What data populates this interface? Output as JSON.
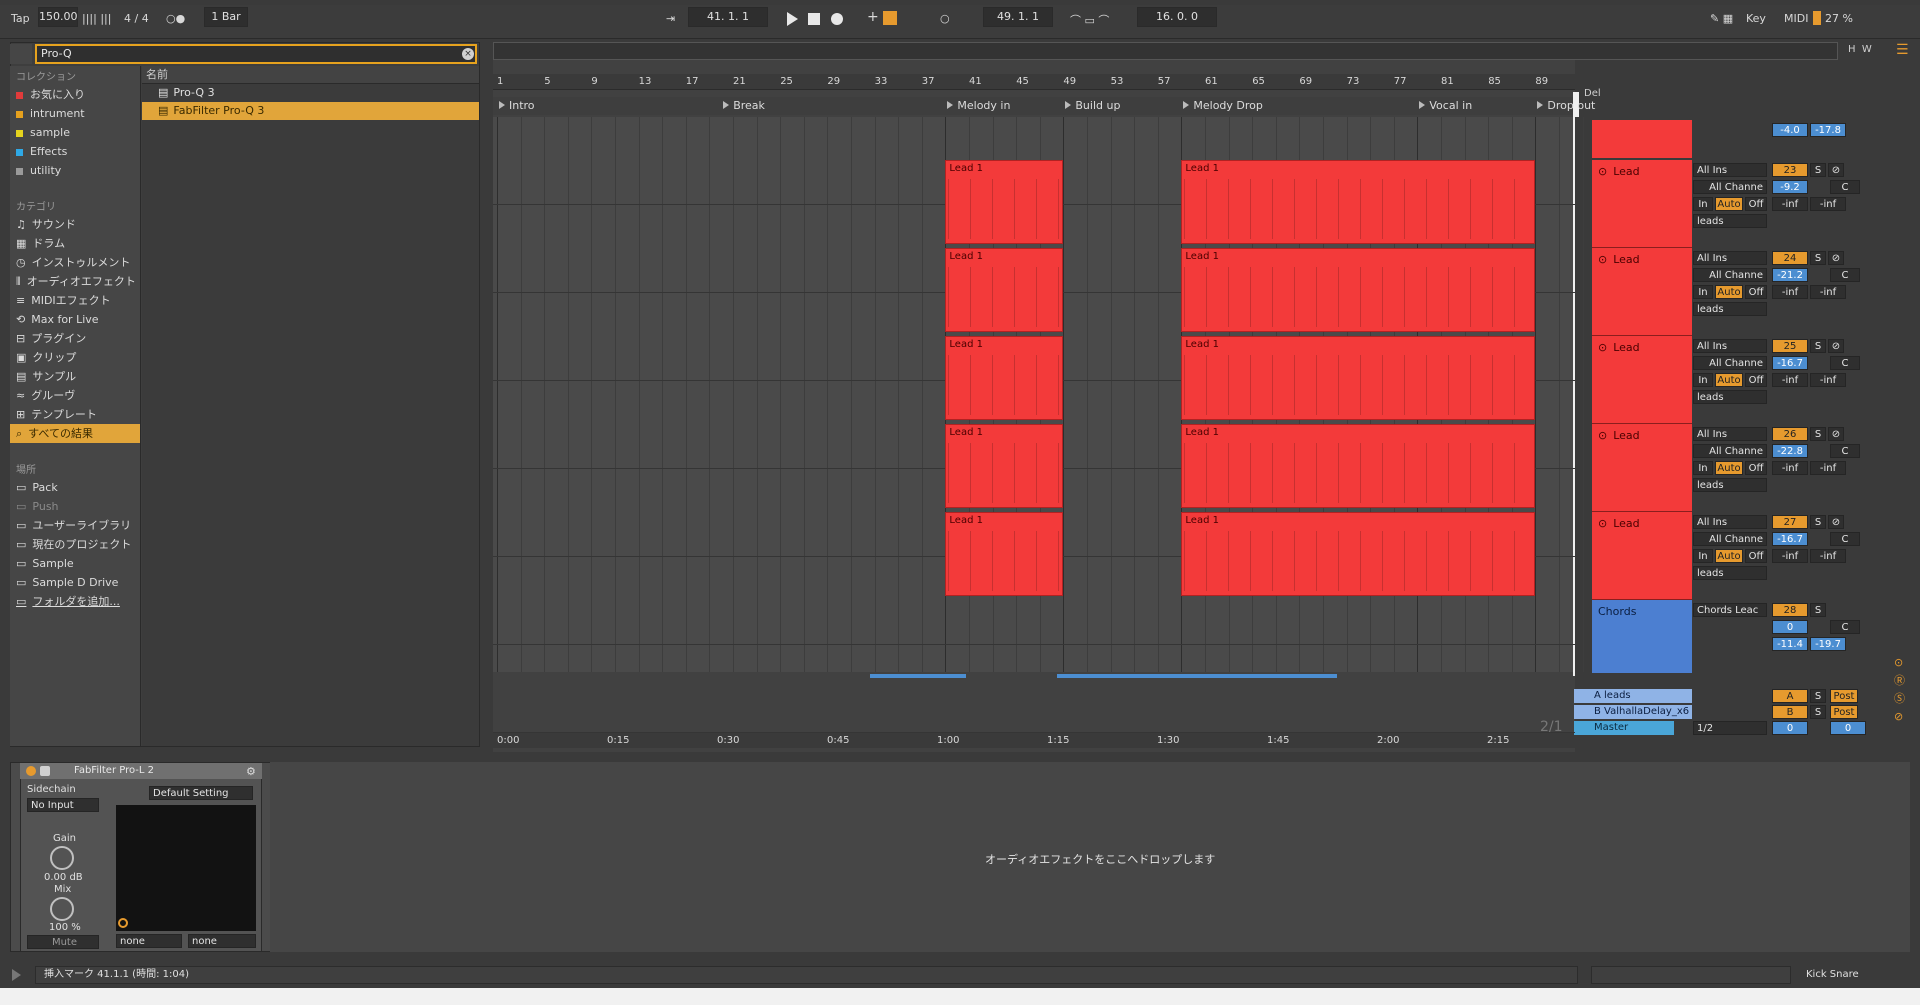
{
  "transport": {
    "tap": "Tap",
    "tempo": "150.00",
    "meter_icons": "||||  |||",
    "signature": "4 / 4",
    "metro": "○●",
    "quantize": "1 Bar",
    "position": "41.  1.  1",
    "loop_start": "49.  1.  1",
    "loop_length": "16.  0.  0",
    "key": "Key",
    "midi": "MIDI",
    "cpu": "27 %"
  },
  "browser": {
    "search_value": "Pro-Q",
    "collections_header": "コレクション",
    "column_header": "名前",
    "collections": [
      {
        "label": "お気に入り",
        "color": "#e03b3b"
      },
      {
        "label": "intrument",
        "color": "#e6a11e"
      },
      {
        "label": "sample",
        "color": "#e6d41e"
      },
      {
        "label": "Effects",
        "color": "#2fa9e6"
      },
      {
        "label": "utility",
        "color": "#9a9a9a"
      }
    ],
    "categories_header": "カテゴリ",
    "categories": [
      "サウンド",
      "ドラム",
      "インストゥルメント",
      "オーディオエフェクト",
      "MIDIエフェクト",
      "Max for Live",
      "プラグイン",
      "クリップ",
      "サンプル",
      "グルーヴ",
      "テンプレート",
      "すべての結果"
    ],
    "places_header": "場所",
    "places": [
      "Pack",
      "Push",
      "ユーザーライブラリ",
      "現在のプロジェクト",
      "Sample",
      "Sample D Drive",
      "フォルダを追加..."
    ],
    "results": [
      {
        "label": "Pro-Q 3",
        "selected": false
      },
      {
        "label": "FabFilter Pro-Q 3",
        "selected": true
      }
    ]
  },
  "arrangement": {
    "ruler": [
      "1",
      "5",
      "9",
      "13",
      "17",
      "21",
      "25",
      "29",
      "33",
      "37",
      "41",
      "45",
      "49",
      "53",
      "57",
      "61",
      "65",
      "69",
      "73",
      "77",
      "81",
      "85",
      "89"
    ],
    "locators": [
      {
        "label": "Intro"
      },
      {
        "label": "Break"
      },
      {
        "label": "Melody in"
      },
      {
        "label": "Build up"
      },
      {
        "label": "Melody Drop"
      },
      {
        "label": "Vocal in"
      },
      {
        "label": "Drop out"
      }
    ],
    "clip_name": "Lead 1",
    "time_ruler": [
      "0:00",
      "0:15",
      "0:30",
      "0:45",
      "1:00",
      "1:15",
      "1:30",
      "1:45",
      "2:00",
      "2:15"
    ],
    "page": "2/1",
    "del_label": "Del"
  },
  "mixer": {
    "top_values": [
      "-4.0",
      "-17.8"
    ],
    "tracks": [
      {
        "name": "Lead",
        "num": "23",
        "vol": "-9.2",
        "peak": "-inf",
        "peak2": "-inf"
      },
      {
        "name": "Lead",
        "num": "24",
        "vol": "-21.2",
        "peak": "-inf",
        "peak2": "-inf"
      },
      {
        "name": "Lead",
        "num": "25",
        "vol": "-16.7",
        "peak": "-inf",
        "peak2": "-inf"
      },
      {
        "name": "Lead",
        "num": "26",
        "vol": "-22.8",
        "peak": "-inf",
        "peak2": "-inf"
      },
      {
        "name": "Lead",
        "num": "27",
        "vol": "-16.7",
        "peak": "-inf",
        "peak2": "-inf"
      }
    ],
    "io_input": "All Ins",
    "io_channel": "All Channe",
    "in_label": "In",
    "auto_label": "Auto",
    "off_label": "Off",
    "out_label": "leads",
    "s_label": "S",
    "c_label": "C",
    "chords": {
      "name": "Chords",
      "input": "Chords Leac",
      "num": "28",
      "vol": "0",
      "peak": "-11.4",
      "peak2": "-19.7"
    },
    "returns": [
      {
        "name": "A leads",
        "letter": "A",
        "post": "Post"
      },
      {
        "name": "B ValhallaDelay_x6",
        "letter": "B",
        "post": "Post"
      }
    ],
    "master": {
      "name": "Master",
      "cue": "1/2",
      "vol": "0",
      "pan": "0"
    }
  },
  "device": {
    "title": "FabFilter Pro-L 2",
    "sidechain": "Sidechain",
    "sidechain_input": "No Input",
    "preset": "Default Setting",
    "gain_label": "Gain",
    "gain_value": "0.00 dB",
    "mix_label": "Mix",
    "mix_value": "100 %",
    "mute": "Mute",
    "none1": "none",
    "none2": "none",
    "drop_hint": "オーディオエフェクトをここへドロップします"
  },
  "status": {
    "text": "挿入マーク 41.1.1 (時間: 1:04)",
    "right": "Kick Snare"
  }
}
